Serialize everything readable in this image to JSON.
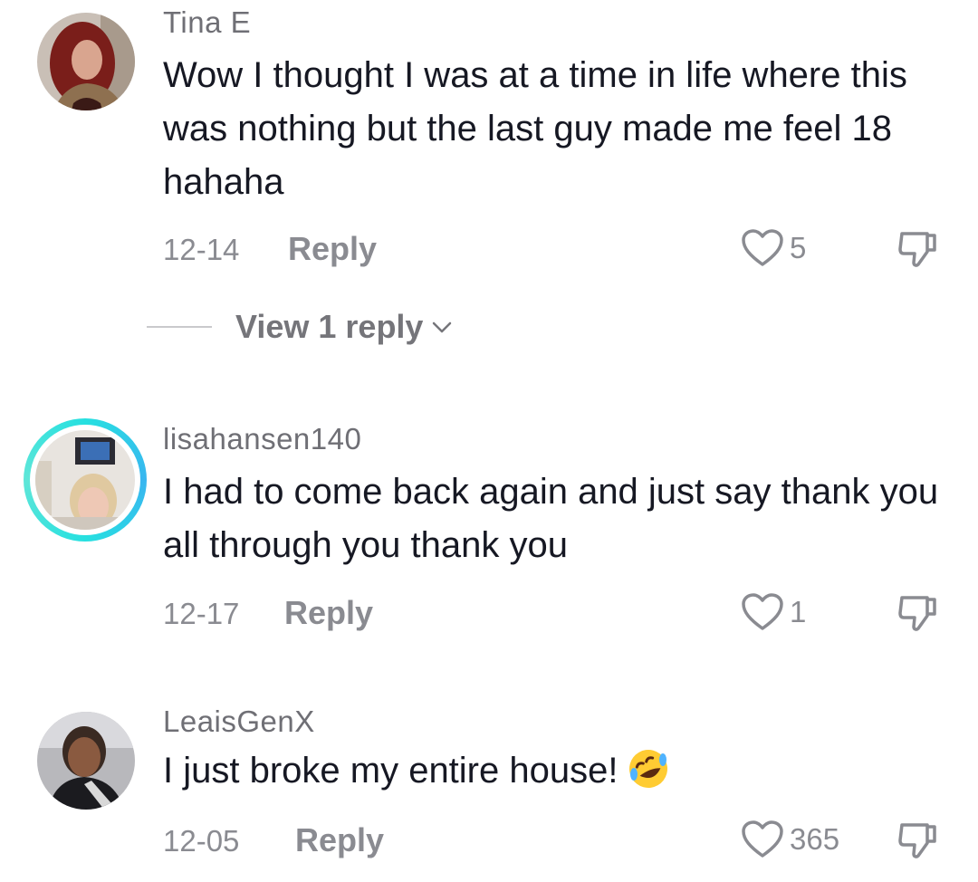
{
  "comments": [
    {
      "username": "Tina E",
      "text": "Wow I thought I was at a time in life where this was nothing but the last guy made me feel 18 hahaha",
      "date": "12-14",
      "reply_label": "Reply",
      "likes": "5",
      "view_replies": "View 1 reply",
      "avatar": "woman-red-hair-avatar"
    },
    {
      "username": "lisahansen140",
      "text": "I had to come back again and just say thank you all through you thank you",
      "date": "12-17",
      "reply_label": "Reply",
      "likes": "1",
      "avatar": "woman-blonde-avatar",
      "has_story_ring": true
    },
    {
      "username": "LeaisGenX",
      "text": "I just broke my entire house!",
      "emoji": "rolling-on-floor-laughing-emoji",
      "date": "12-05",
      "reply_label": "Reply",
      "likes": "365",
      "avatar": "woman-car-selfie-avatar"
    }
  ],
  "colors": {
    "text": "#161823",
    "muted": "#8a8b91",
    "story_ring": "#26e0e0"
  }
}
